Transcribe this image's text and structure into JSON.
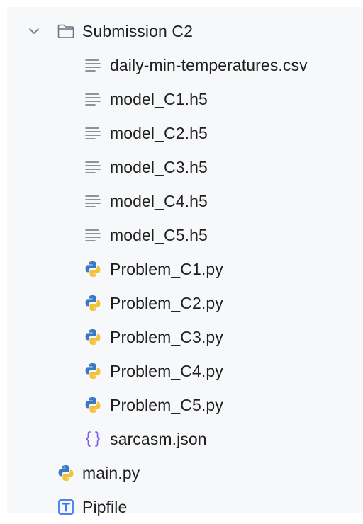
{
  "tree": {
    "folder": {
      "name": "Submission C2",
      "expanded": true,
      "icon": "folder-icon",
      "children": [
        {
          "name": "daily-min-temperatures.csv",
          "icon": "text-file-icon"
        },
        {
          "name": "model_C1.h5",
          "icon": "text-file-icon"
        },
        {
          "name": "model_C2.h5",
          "icon": "text-file-icon"
        },
        {
          "name": "model_C3.h5",
          "icon": "text-file-icon"
        },
        {
          "name": "model_C4.h5",
          "icon": "text-file-icon"
        },
        {
          "name": "model_C5.h5",
          "icon": "text-file-icon"
        },
        {
          "name": "Problem_C1.py",
          "icon": "python-file-icon"
        },
        {
          "name": "Problem_C2.py",
          "icon": "python-file-icon"
        },
        {
          "name": "Problem_C3.py",
          "icon": "python-file-icon"
        },
        {
          "name": "Problem_C4.py",
          "icon": "python-file-icon"
        },
        {
          "name": "Problem_C5.py",
          "icon": "python-file-icon"
        },
        {
          "name": "sarcasm.json",
          "icon": "json-file-icon"
        }
      ]
    },
    "root_files": [
      {
        "name": "main.py",
        "icon": "python-file-icon"
      },
      {
        "name": "Pipfile",
        "icon": "pipfile-icon"
      }
    ]
  },
  "colors": {
    "panel_bg": "#f7f8fa",
    "text": "#1f1f1f",
    "icon_gray": "#6c707e",
    "python_blue": "#3b78c4",
    "python_yellow": "#f4c23a",
    "json_purple": "#7a5cf0",
    "pipfile_blue": "#3574f0"
  }
}
